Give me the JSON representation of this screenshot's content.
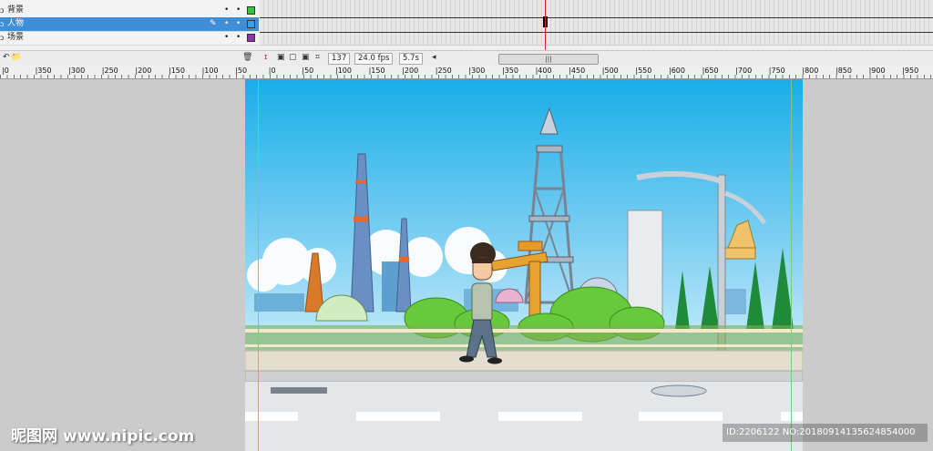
{
  "layers": [
    {
      "name": "背景",
      "color": "#3cc040",
      "selected": false
    },
    {
      "name": "人物",
      "color": "#28a8e8",
      "selected": true
    },
    {
      "name": "场景",
      "color": "#8a38a8",
      "selected": false
    }
  ],
  "timeline_status": {
    "current_frame": "137",
    "fps": "24.0 fps",
    "elapsed": "5.7s",
    "scroll_grip": "|||"
  },
  "ruler_labels": [
    "0",
    "350",
    "300",
    "250",
    "200",
    "150",
    "100",
    "50",
    "0",
    "50",
    "100",
    "150",
    "200",
    "250",
    "300",
    "350",
    "400",
    "450",
    "500",
    "550",
    "600",
    "650",
    "700",
    "750",
    "800",
    "850",
    "900",
    "950"
  ],
  "watermark": {
    "site": "昵图网 www.nipic.com",
    "id": "ID:2206122 NO:20180914135624854000"
  }
}
